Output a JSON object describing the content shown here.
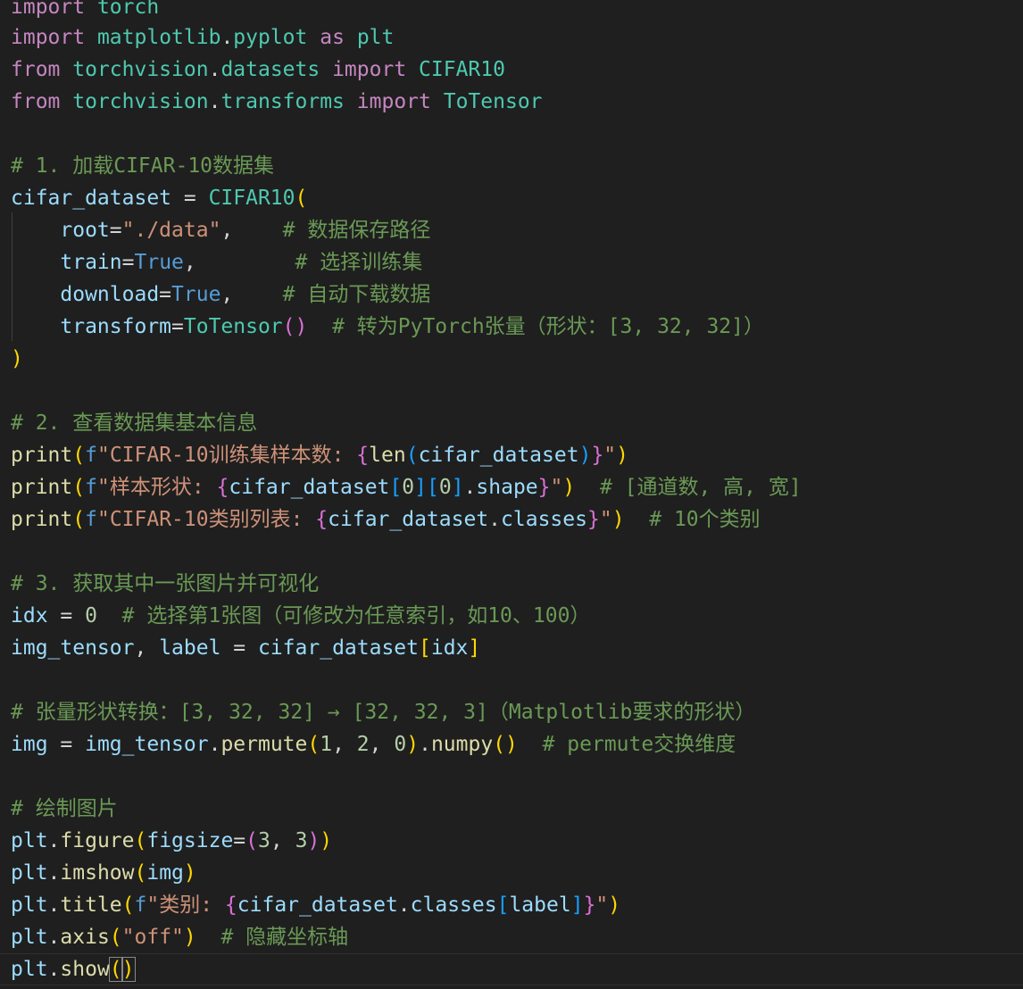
{
  "lines": [
    [
      "import",
      " ",
      "torch"
    ],
    [
      "import",
      " ",
      "matplotlib",
      ".",
      "pyplot",
      " ",
      "as",
      " ",
      "plt"
    ],
    [
      "from",
      " ",
      "torchvision",
      ".",
      "datasets",
      " ",
      "import",
      " ",
      "CIFAR10"
    ],
    [
      "from",
      " ",
      "torchvision",
      ".",
      "transforms",
      " ",
      "import",
      " ",
      "ToTensor"
    ],
    [
      "# 1. 加载CIFAR-10数据集"
    ],
    [
      "cifar_dataset",
      " = ",
      "CIFAR10",
      "("
    ],
    [
      "    ",
      "root",
      "=",
      "\"./data\"",
      ",    ",
      "# 数据保存路径"
    ],
    [
      "    ",
      "train",
      "=",
      "True",
      ",        ",
      "# 选择训练集"
    ],
    [
      "    ",
      "download",
      "=",
      "True",
      ",    ",
      "# 自动下载数据"
    ],
    [
      "    ",
      "transform",
      "=",
      "ToTensor",
      "()",
      "  ",
      "# 转为PyTorch张量（形状：[3, 32, 32]）"
    ],
    [
      ")"
    ],
    [
      "# 2. 查看数据集基本信息"
    ],
    [
      "print",
      "(",
      "f",
      "\"CIFAR-10训练集样本数: ",
      "{",
      "len",
      "(",
      "cifar_dataset",
      ")",
      "}",
      "\"",
      ")"
    ],
    [
      "print",
      "(",
      "f",
      "\"样本形状: ",
      "{",
      "cifar_dataset",
      "[",
      "0",
      "]",
      "[",
      "0",
      "]",
      ".",
      "shape",
      "}",
      "\"",
      ")",
      "  ",
      "# [通道数, 高, 宽]"
    ],
    [
      "print",
      "(",
      "f",
      "\"CIFAR-10类别列表: ",
      "{",
      "cifar_dataset",
      ".",
      "classes",
      "}",
      "\"",
      ")",
      "  ",
      "# 10个类别"
    ],
    [
      "# 3. 获取其中一张图片并可视化"
    ],
    [
      "idx",
      " = ",
      "0",
      "  ",
      "# 选择第1张图（可修改为任意索引，如10、100）"
    ],
    [
      "img_tensor",
      ", ",
      "label",
      " = ",
      "cifar_dataset",
      "[",
      "idx",
      "]"
    ],
    [
      "# 张量形状转换：[3, 32, 32] → [32, 32, 3]（Matplotlib要求的形状）"
    ],
    [
      "img",
      " = ",
      "img_tensor",
      ".",
      "permute",
      "(",
      "1",
      ", ",
      "2",
      ", ",
      "0",
      ")",
      ".",
      "numpy",
      "()",
      "  ",
      "# permute交换维度"
    ],
    [
      "# 绘制图片"
    ],
    [
      "plt",
      ".",
      "figure",
      "(",
      "figsize",
      "=",
      "(",
      "3",
      ", ",
      "3",
      ")",
      ")"
    ],
    [
      "plt",
      ".",
      "imshow",
      "(",
      "img",
      ")"
    ],
    [
      "plt",
      ".",
      "title",
      "(",
      "f",
      "\"类别: ",
      "{",
      "cifar_dataset",
      ".",
      "classes",
      "[",
      "label",
      "]",
      "}",
      "\"",
      ")"
    ],
    [
      "plt",
      ".",
      "axis",
      "(",
      "\"off\"",
      ")",
      "  ",
      "# 隐藏坐标轴"
    ],
    [
      "plt",
      ".",
      "show",
      "(",
      ")"
    ]
  ]
}
